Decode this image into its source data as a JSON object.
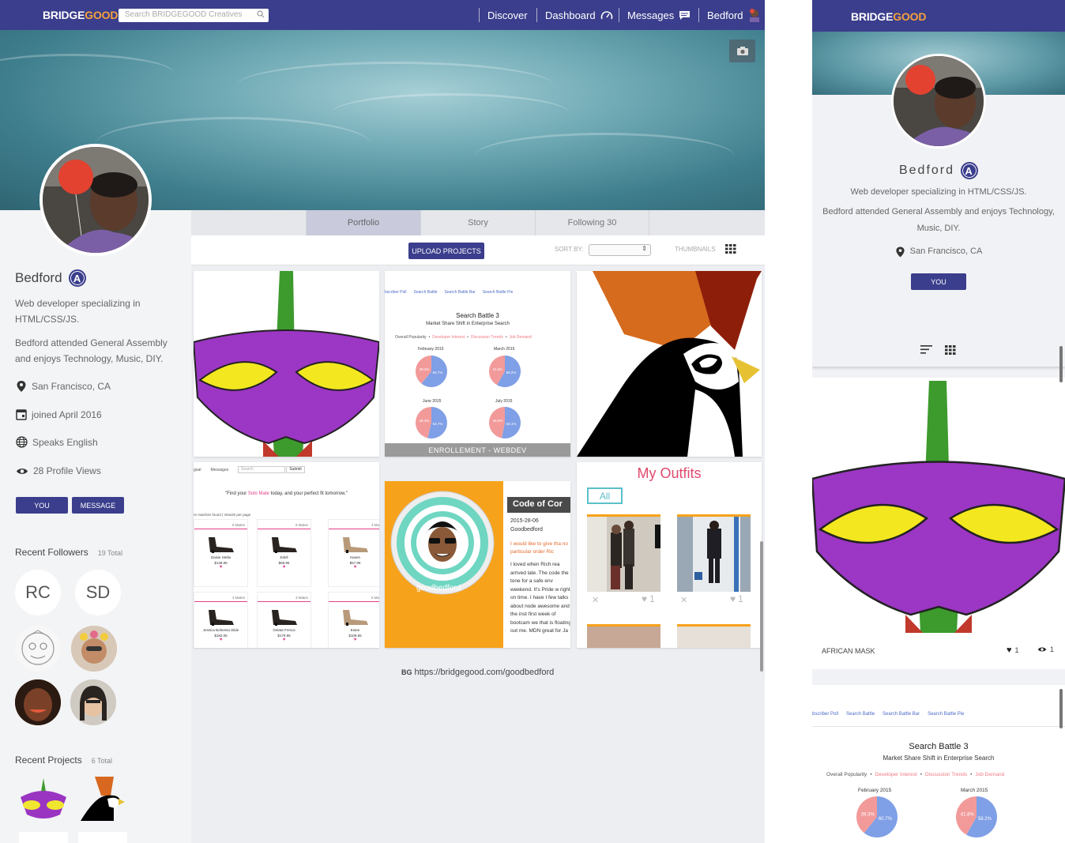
{
  "brand": {
    "logo_white": "BRIDGE",
    "logo_orange": "GOOD"
  },
  "search": {
    "placeholder": "Search BRIDGEGOOD Creatives"
  },
  "nav": {
    "discover": "Discover",
    "dashboard": "Dashboard",
    "messages": "Messages",
    "user": "Bedford"
  },
  "profile": {
    "name": "Bedford",
    "badge": "A",
    "bio": "Web developer specializing in HTML/CSS/JS.",
    "about": "Bedford attended General Assembly and enjoys Technology, Music, DIY.",
    "location": "San Francisco, CA",
    "joined": "joined April 2016",
    "language": "Speaks English",
    "views": "28 Profile Views",
    "you_label": "YOU",
    "message_label": "MESSAGE"
  },
  "followers": {
    "title": "Recent Followers",
    "count": "19 Total",
    "initials": [
      "RC",
      "SD"
    ]
  },
  "projects": {
    "title": "Recent Projects",
    "count": "6 Total"
  },
  "tabs": [
    "Portfolio",
    "Story",
    "Following 30"
  ],
  "toolbar": {
    "upload": "UPLOAD PROJECTS",
    "sort_by": "SORT BY:",
    "thumbnails": "THUMBNAILS"
  },
  "cards": {
    "search_battle": {
      "tabs": [
        "bscriber Poll",
        "Search Battle",
        "Search Battle Bar",
        "Search Battle Pie"
      ],
      "title": "Search Battle 3",
      "subtitle": "Market Share Shift in Enterprise Search",
      "legend_label": "Overall Popularity",
      "legend_items": [
        "Developer Interest",
        "Discussion Trends",
        "Job Demand"
      ],
      "months": [
        "February 2015",
        "March 2015",
        "June 2015",
        "July 2015"
      ],
      "overlay": "ENROLLEMENT - WEBDEV",
      "pies": [
        {
          "pink": 39.3,
          "blue": 60.7
        },
        {
          "pink": 41.8,
          "blue": 58.2
        },
        {
          "pink": 46.3,
          "blue": 53.7
        },
        {
          "pink": 46.9,
          "blue": 53.1
        }
      ]
    },
    "solo_mate": {
      "menu": [
        "goal",
        "Messages"
      ],
      "search": "Search",
      "submit": "Submit",
      "tagline_pre": "\"Find your ",
      "tagline_brand": "Solo Mate",
      "tagline_post": " today, and your perfect fit tomorrow.\"",
      "found": "re matches found | View20 per page",
      "products": [
        {
          "match": "6 Mates",
          "name": "Daisie Stella",
          "price": "$139.95"
        },
        {
          "match": "6 Mates",
          "name": "Edell",
          "price": "$68.95"
        },
        {
          "match": "3 Ma",
          "name": "Haven",
          "price": "$57.99"
        },
        {
          "match": "3 Mates",
          "name": "Jessica Bohemia Slide",
          "price": "$182.05"
        },
        {
          "match": "3 Mates",
          "name": "Gelata Fresca",
          "price": "$179.95"
        },
        {
          "match": "6 Ma",
          "name": "Estee",
          "price": "$109.95"
        }
      ]
    },
    "code_of_conduct": {
      "title": "Code of Cor",
      "date": "2015-28-06",
      "author": "Goodbedford",
      "intro": "I would like to give tha no particular order Ric",
      "body": "I loved when Rich rea arrived late. The code the tone for a safe env weekend. It's Pride w right on time. I have t few talks about node awesome and the inst first week of bootcam we that is floating out me. MDN great for Ja",
      "handle": "goodbedford"
    },
    "outfits": {
      "title": "My Outfits",
      "filter": "All",
      "likes": [
        "1",
        "1"
      ]
    }
  },
  "footer": {
    "logo": "BG",
    "url": "https://bridgegood.com/goodbedford"
  },
  "mobile": {
    "card_title": "AFRICAN MASK",
    "likes": "1",
    "views": "1"
  },
  "colors": {
    "brand": "#3b3e8c",
    "accent": "#f4a23b",
    "outfits": "#e04a6e"
  }
}
